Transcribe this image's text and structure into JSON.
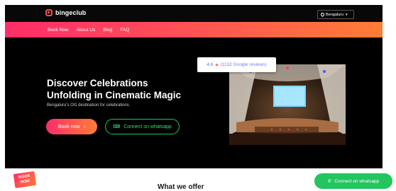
{
  "brand": {
    "name": "bingeclub"
  },
  "header": {
    "city": "Bengaluru",
    "nav": [
      "Book Now",
      "About Us",
      "Blog",
      "FAQ"
    ]
  },
  "hero": {
    "title_line1": "Discover Celebrations",
    "title_line2": "Unfolding in Cinematic Magic",
    "subtitle": "Bengaluru's OG destination for celebrations",
    "book_button": "Book now",
    "whatsapp_button": "Connect on whatsapp",
    "rating": {
      "score": "4.6",
      "reviews": "(1132 Google reviews)"
    }
  },
  "badge": {
    "line1": "BOOK",
    "line2": "NOW"
  },
  "section": {
    "title": "What we offer"
  },
  "float_whatsapp": {
    "label": "Connect on whatsapp"
  },
  "colors": {
    "accent_start": "#ff2d68",
    "accent_end": "#ff7d35",
    "whatsapp": "#22c55e"
  }
}
